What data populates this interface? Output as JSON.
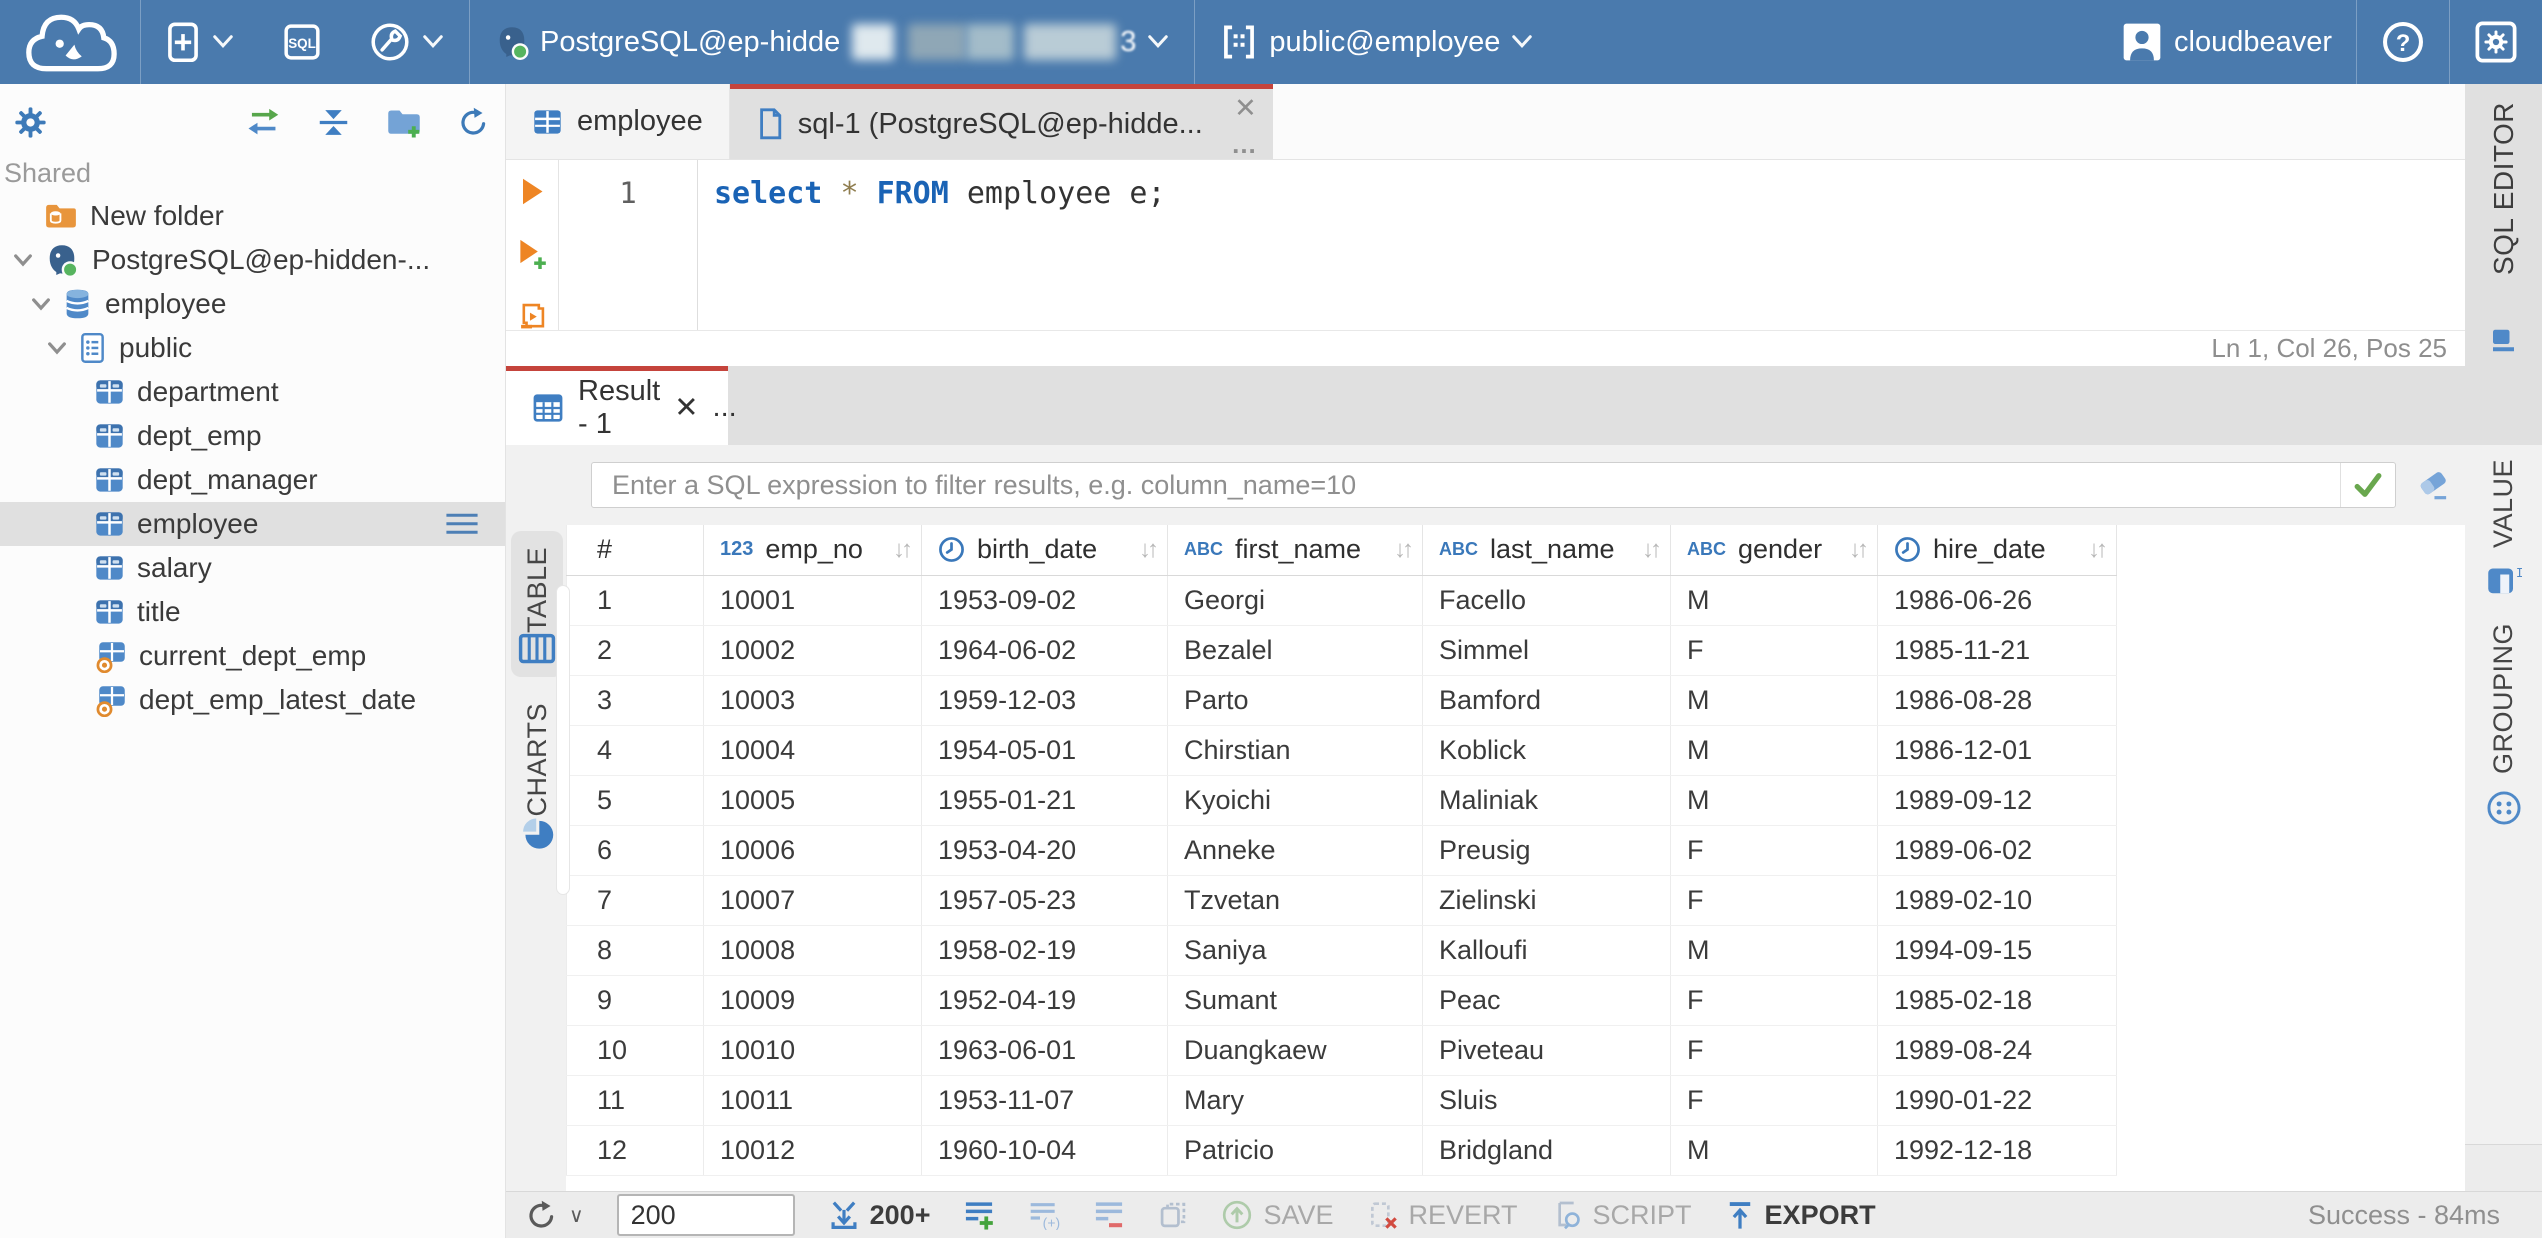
{
  "header": {
    "sql_badge": "SQL",
    "connection_label": "PostgreSQL@ep-hidde",
    "connection_suffix": "3",
    "schema_selector": "public@employee",
    "username": "cloudbeaver"
  },
  "sidebar": {
    "section": "Shared",
    "tree": [
      {
        "label": "New folder",
        "icon": "folderdb",
        "depth": 0,
        "chevron": false
      },
      {
        "label": "PostgreSQL@ep-hidden-...",
        "icon": "postgres",
        "depth": 0,
        "chevron": true
      },
      {
        "label": "employee",
        "icon": "database",
        "depth": 1,
        "chevron": true
      },
      {
        "label": "public",
        "icon": "schema",
        "depth": 2,
        "chevron": true
      },
      {
        "label": "department",
        "icon": "table",
        "depth": 3,
        "chevron": false
      },
      {
        "label": "dept_emp",
        "icon": "table",
        "depth": 3,
        "chevron": false
      },
      {
        "label": "dept_manager",
        "icon": "table",
        "depth": 3,
        "chevron": false
      },
      {
        "label": "employee",
        "icon": "table",
        "depth": 3,
        "chevron": false,
        "selected": true
      },
      {
        "label": "salary",
        "icon": "table",
        "depth": 3,
        "chevron": false
      },
      {
        "label": "title",
        "icon": "table",
        "depth": 3,
        "chevron": false
      },
      {
        "label": "current_dept_emp",
        "icon": "view",
        "depth": 3,
        "chevron": false
      },
      {
        "label": "dept_emp_latest_date",
        "icon": "view",
        "depth": 3,
        "chevron": false
      }
    ]
  },
  "tabs": {
    "employee": "employee",
    "sql": "sql-1 (PostgreSQL@ep-hidde...",
    "close": "✕",
    "overflow": "..."
  },
  "editor": {
    "line_number": "1",
    "tokens": [
      {
        "text": "select",
        "type": "keyword"
      },
      {
        "text": " ",
        "type": "plain"
      },
      {
        "text": "*",
        "type": "operator"
      },
      {
        "text": " ",
        "type": "plain"
      },
      {
        "text": "FROM",
        "type": "keyword"
      },
      {
        "text": " employee e;",
        "type": "plain"
      }
    ],
    "status": "Ln 1, Col 26, Pos 25",
    "side_tab": "SQL EDITOR"
  },
  "result": {
    "tab": "Result - 1",
    "close": "✕",
    "overflow": "...",
    "filter_placeholder": "Enter a SQL expression to filter results, e.g. column_name=10",
    "side_tabs_left": [
      "TABLE",
      "CHARTS"
    ],
    "side_tabs_right": [
      "VALUE",
      "GROUPING"
    ],
    "grid": {
      "sort_glyph": "↓↑",
      "columns": [
        {
          "name": "#",
          "type": "rownum"
        },
        {
          "name": "emp_no",
          "type": "number"
        },
        {
          "name": "birth_date",
          "type": "datetime"
        },
        {
          "name": "first_name",
          "type": "string"
        },
        {
          "name": "last_name",
          "type": "string"
        },
        {
          "name": "gender",
          "type": "string"
        },
        {
          "name": "hire_date",
          "type": "datetime"
        }
      ],
      "rows": [
        [
          "1",
          "10001",
          "1953-09-02",
          "Georgi",
          "Facello",
          "M",
          "1986-06-26"
        ],
        [
          "2",
          "10002",
          "1964-06-02",
          "Bezalel",
          "Simmel",
          "F",
          "1985-11-21"
        ],
        [
          "3",
          "10003",
          "1959-12-03",
          "Parto",
          "Bamford",
          "M",
          "1986-08-28"
        ],
        [
          "4",
          "10004",
          "1954-05-01",
          "Chirstian",
          "Koblick",
          "M",
          "1986-12-01"
        ],
        [
          "5",
          "10005",
          "1955-01-21",
          "Kyoichi",
          "Maliniak",
          "M",
          "1989-09-12"
        ],
        [
          "6",
          "10006",
          "1953-04-20",
          "Anneke",
          "Preusig",
          "F",
          "1989-06-02"
        ],
        [
          "7",
          "10007",
          "1957-05-23",
          "Tzvetan",
          "Zielinski",
          "F",
          "1989-02-10"
        ],
        [
          "8",
          "10008",
          "1958-02-19",
          "Saniya",
          "Kalloufi",
          "M",
          "1994-09-15"
        ],
        [
          "9",
          "10009",
          "1952-04-19",
          "Sumant",
          "Peac",
          "F",
          "1985-02-18"
        ],
        [
          "10",
          "10010",
          "1963-06-01",
          "Duangkaew",
          "Piveteau",
          "F",
          "1989-08-24"
        ],
        [
          "11",
          "10011",
          "1953-11-07",
          "Mary",
          "Sluis",
          "F",
          "1990-01-22"
        ],
        [
          "12",
          "10012",
          "1960-10-04",
          "Patricio",
          "Bridgland",
          "M",
          "1992-12-18"
        ]
      ]
    },
    "toolbar": {
      "row_limit": "200",
      "fetch_more": "200+",
      "save": "SAVE",
      "revert": "REVERT",
      "script": "SCRIPT",
      "export": "EXPORT",
      "status": "Success - 84ms"
    }
  },
  "colors": {
    "header_bg": "#4a7aad",
    "accent_red": "#c5443c",
    "icon_blue": "#3f7ec2",
    "selection_gray": "#e0e0e0"
  }
}
